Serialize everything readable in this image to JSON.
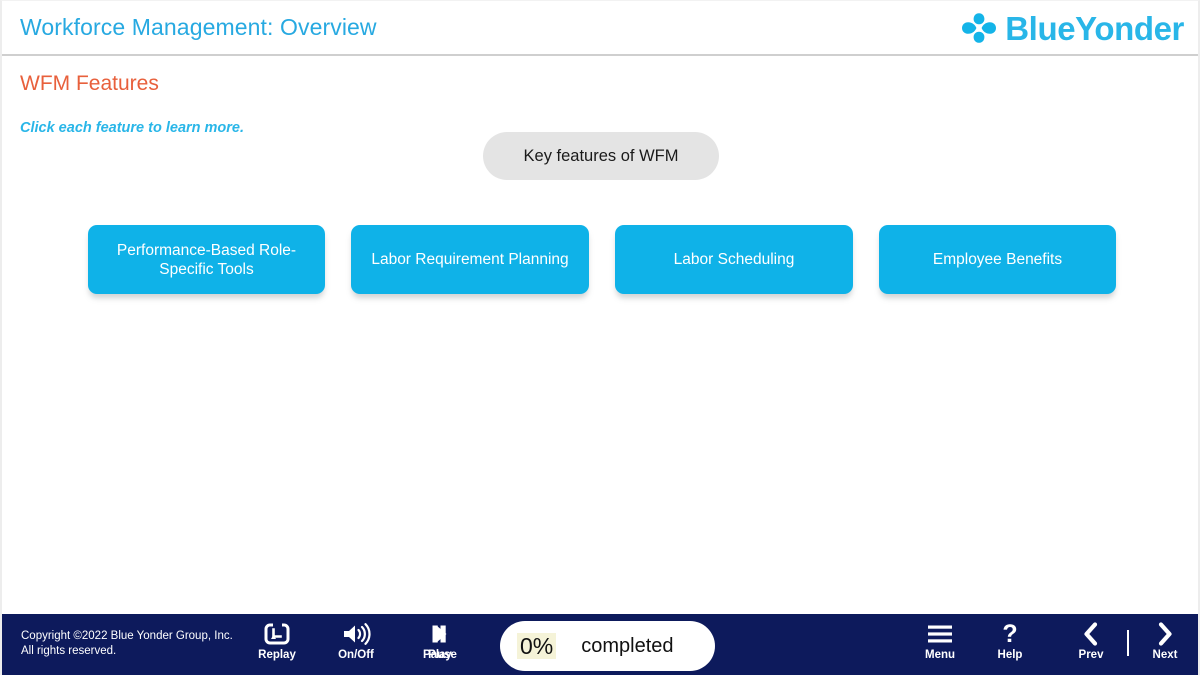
{
  "header": {
    "title": "Workforce Management: Overview",
    "logo_text": "BlueYonder",
    "logo_mark": "blue-yonder-petals-icon",
    "accent_color": "#27a9e1"
  },
  "content": {
    "section_title": "WFM Features",
    "section_title_color": "#e8603c",
    "instruction": "Click each feature to learn more.",
    "instruction_color": "#29b6e8",
    "key_pill_label": "Key features of WFM",
    "features": [
      {
        "label": "Performance-Based Role-Specific Tools"
      },
      {
        "label": "Labor Requirement Planning"
      },
      {
        "label": "Labor Scheduling"
      },
      {
        "label": "Employee Benefits"
      }
    ],
    "feature_color": "#0fb2e8"
  },
  "toolbar": {
    "background_color": "#0d1a5c",
    "copyright_line1": "Copyright ©2022 Blue Yonder Group, Inc.",
    "copyright_line2": "All rights reserved.",
    "replay_label": "Replay",
    "replay_icon": "replay-loop-icon",
    "onoff_label": "On/Off",
    "onoff_icon": "speaker-sound-icon",
    "pause_label": "Pause",
    "play_label": "Play",
    "playpause_icon": "play-pause-icon",
    "menu_label": "Menu",
    "menu_icon": "hamburger-menu-icon",
    "help_label": "Help",
    "help_icon": "question-mark-icon",
    "prev_label": "Prev",
    "prev_icon": "chevron-left-icon",
    "next_label": "Next",
    "next_icon": "chevron-right-icon",
    "progress_value": "0%",
    "progress_text": "completed",
    "progress_highlight_color": "#f5f3d8"
  }
}
